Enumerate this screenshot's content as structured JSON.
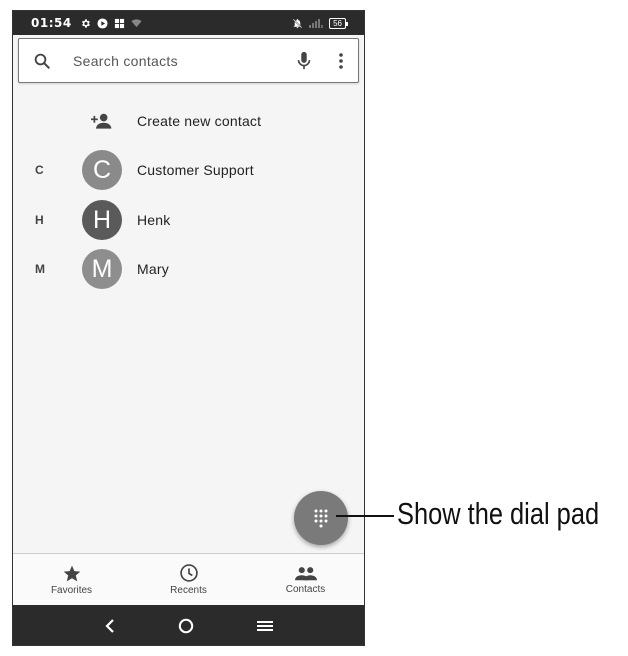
{
  "status_bar": {
    "time": "01:54",
    "battery": "56",
    "icons_left": [
      "gear-icon",
      "play-icon",
      "grid-icon",
      "wifi-icon"
    ],
    "icons_right": [
      "bell-off-icon",
      "signal-icon",
      "battery-icon"
    ]
  },
  "search": {
    "placeholder": "Search contacts",
    "icons": [
      "search-icon",
      "mic-icon",
      "more-vert-icon"
    ]
  },
  "create_contact": {
    "label": "Create new contact",
    "icon": "person-add-icon"
  },
  "contacts": [
    {
      "section": "C",
      "initial": "C",
      "name": "Customer Support",
      "avatar_color": "#8a8a8a"
    },
    {
      "section": "H",
      "initial": "H",
      "name": "Henk",
      "avatar_color": "#5a5a5a"
    },
    {
      "section": "M",
      "initial": "M",
      "name": "Mary",
      "avatar_color": "#8e8e8e"
    }
  ],
  "fab": {
    "icon": "dialpad-icon"
  },
  "bottom_nav": [
    {
      "label": "Favorites",
      "icon": "star-icon"
    },
    {
      "label": "Recents",
      "icon": "clock-icon"
    },
    {
      "label": "Contacts",
      "icon": "people-icon"
    }
  ],
  "system_nav": {
    "icons": [
      "back-icon",
      "home-icon",
      "menu-icon"
    ]
  },
  "callout": {
    "text": "Show the dial pad"
  },
  "colors": {
    "status_bar": "#2b2b2b",
    "background": "#f5f5f5",
    "fab": "#7a7a7a"
  }
}
